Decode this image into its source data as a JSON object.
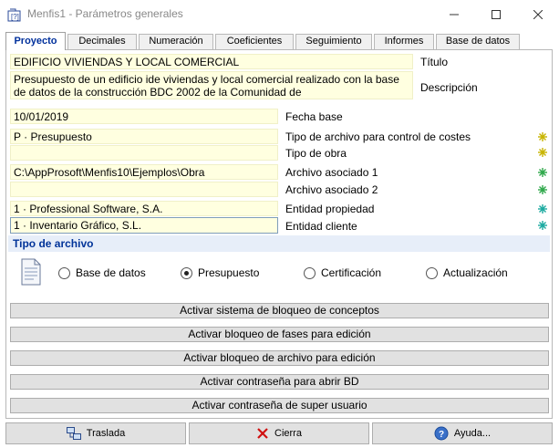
{
  "window": {
    "title": "Menfis1 - Parámetros generales"
  },
  "tabs": [
    {
      "label": "Proyecto",
      "active": true
    },
    {
      "label": "Decimales"
    },
    {
      "label": "Numeración"
    },
    {
      "label": "Coeficientes"
    },
    {
      "label": "Seguimiento"
    },
    {
      "label": "Informes"
    },
    {
      "label": "Base de datos"
    }
  ],
  "form": {
    "titulo": {
      "value": "EDIFICIO VIVIENDAS Y LOCAL COMERCIAL",
      "label": "Título"
    },
    "descripcion": {
      "value": "Presupuesto de un edificio ide viviendas y local comercial realizado con la base de datos de la construcción BDC 2002 de la Comunidad de",
      "label": "Descripción"
    },
    "fecha_base": {
      "value": "10/01/2019",
      "label": "Fecha base"
    },
    "tipo_archivo_costes": {
      "value": "P · Presupuesto",
      "label": "Tipo de archivo para control de costes"
    },
    "tipo_obra": {
      "value": "",
      "label": "Tipo de obra"
    },
    "archivo_asociado_1": {
      "value": "C:\\AppProsoft\\Menfis10\\Ejemplos\\Obra",
      "label": "Archivo asociado 1"
    },
    "archivo_asociado_2": {
      "value": "",
      "label": "Archivo asociado 2"
    },
    "entidad_propiedad": {
      "value": "1 · Professional Software, S.A.",
      "label": "Entidad propiedad"
    },
    "entidad_cliente": {
      "value": "1 · Inventario Gráfico, S.L.",
      "label": "Entidad cliente"
    }
  },
  "tipo_archivo": {
    "header": "Tipo de archivo",
    "options": [
      {
        "label": "Base de datos",
        "checked": false
      },
      {
        "label": "Presupuesto",
        "checked": true
      },
      {
        "label": "Certificación",
        "checked": false
      },
      {
        "label": "Actualización",
        "checked": false
      }
    ]
  },
  "actions": [
    "Activar sistema de bloqueo de conceptos",
    "Activar bloqueo de fases para edición",
    "Activar bloqueo de archivo para edición",
    "Activar contraseña para abrir BD",
    "Activar contraseña de super usuario"
  ],
  "footer": {
    "traslada": "Traslada",
    "cierra": "Cierra",
    "ayuda": "Ayuda..."
  },
  "colors": {
    "accent": "#003399",
    "field_bg": "#ffffe0",
    "star_yellow": "#c8b400",
    "star_green": "#2ea84a",
    "star_teal": "#1aa9a0"
  }
}
